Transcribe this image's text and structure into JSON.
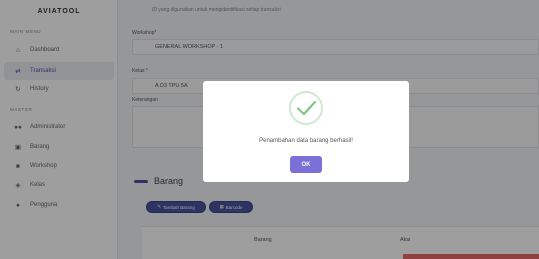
{
  "sidebar": {
    "brand": "AVIATOOL",
    "section_main": "MAIN MENU",
    "section_master": "MASTER",
    "items": [
      {
        "label": "Dashboard",
        "icon": "home-icon"
      },
      {
        "label": "Transaksi",
        "icon": "transfer-icon",
        "active": true
      },
      {
        "label": "History",
        "icon": "history-icon"
      },
      {
        "label": "Administrator",
        "icon": "users-icon"
      },
      {
        "label": "Barang",
        "icon": "box-icon"
      },
      {
        "label": "Workshop",
        "icon": "building-icon"
      },
      {
        "label": "Kelas",
        "icon": "tag-icon"
      },
      {
        "label": "Pengguna",
        "icon": "user-icon"
      }
    ]
  },
  "form": {
    "hint": "ID yang digunakan untuk mengidentifikasi setiap transaksi",
    "workshop_label": "Workshop*",
    "workshop_value": "GENERAL WORKSHOP - 1",
    "kelas_label": "Kelas *",
    "kelas_value": "A   D3 TPU 5A",
    "keterangan_label": "Keterangan"
  },
  "barang": {
    "title": "Barang",
    "add_button": "Tambah Barang",
    "barcode_button": "Barcode",
    "columns": [
      "Barang",
      "Aksi"
    ]
  },
  "modal": {
    "message": "Penambahan data barang berhasil!",
    "ok": "OK",
    "icon": "success-check-icon"
  },
  "colors": {
    "accent": "#4a55a2",
    "ok_button": "#7b6fd8",
    "success": "#7ec87e",
    "danger": "#e0453d"
  }
}
